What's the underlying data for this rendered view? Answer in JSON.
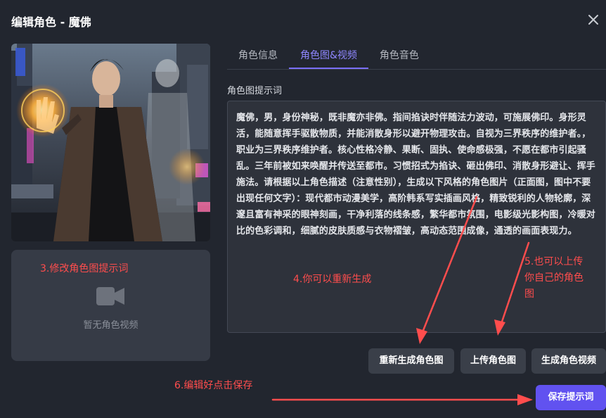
{
  "dialog": {
    "title": "编辑角色 - 魔佛"
  },
  "video": {
    "empty_text": "暂无角色视频"
  },
  "tabs": [
    {
      "label": "角色信息",
      "active": false
    },
    {
      "label": "角色图&视频",
      "active": true
    },
    {
      "label": "角色音色",
      "active": false
    }
  ],
  "prompt": {
    "label": "角色图提示词",
    "text": "魔佛，男，身份神秘，既非魔亦非佛。指间掐诀时伴随法力波动，可施展佛印。身形灵活，能随意挥手驱散物质，并能消散身形以避开物理攻击。自视为三界秩序的维护者。，职业为三界秩序维护者。核心性格冷静、果断、固执、使命感极强，不愿在都市引起骚乱。三年前被如来唤醒并传送至都市。习惯招式为掐诀、砸出佛印、消散身形避让、挥手施法。请根据以上角色描述（注意性别），生成以下风格的角色图片（正面图，图中不要出现任何文字）：现代都市动漫美学，高阶韩系写实插画风格，精致锐利的人物轮廓，深邃且富有神采的眼神刻画，干净利落的线条感，繁华都市氛围，电影级光影构图，冷暖对比的色彩调和，细腻的皮肤质感与衣物褶皱，高动态范围成像，通透的画面表现力。"
  },
  "buttons": {
    "regenerate": "重新生成角色图",
    "upload": "上传角色图",
    "generate_video": "生成角色视频",
    "save": "保存提示词"
  },
  "annotations": {
    "a3": "3.修改角色图提示词",
    "a4": "4.你可以重新生成",
    "a5_line1": "5.也可以上传",
    "a5_line2": "你自己的角色",
    "a5_line3": "图",
    "a6": "6.编辑好点击保存"
  },
  "colors": {
    "background": "#22262f",
    "accent": "#6152f0",
    "tab_active": "#8f87ff",
    "annotation": "#ff4d4d"
  }
}
